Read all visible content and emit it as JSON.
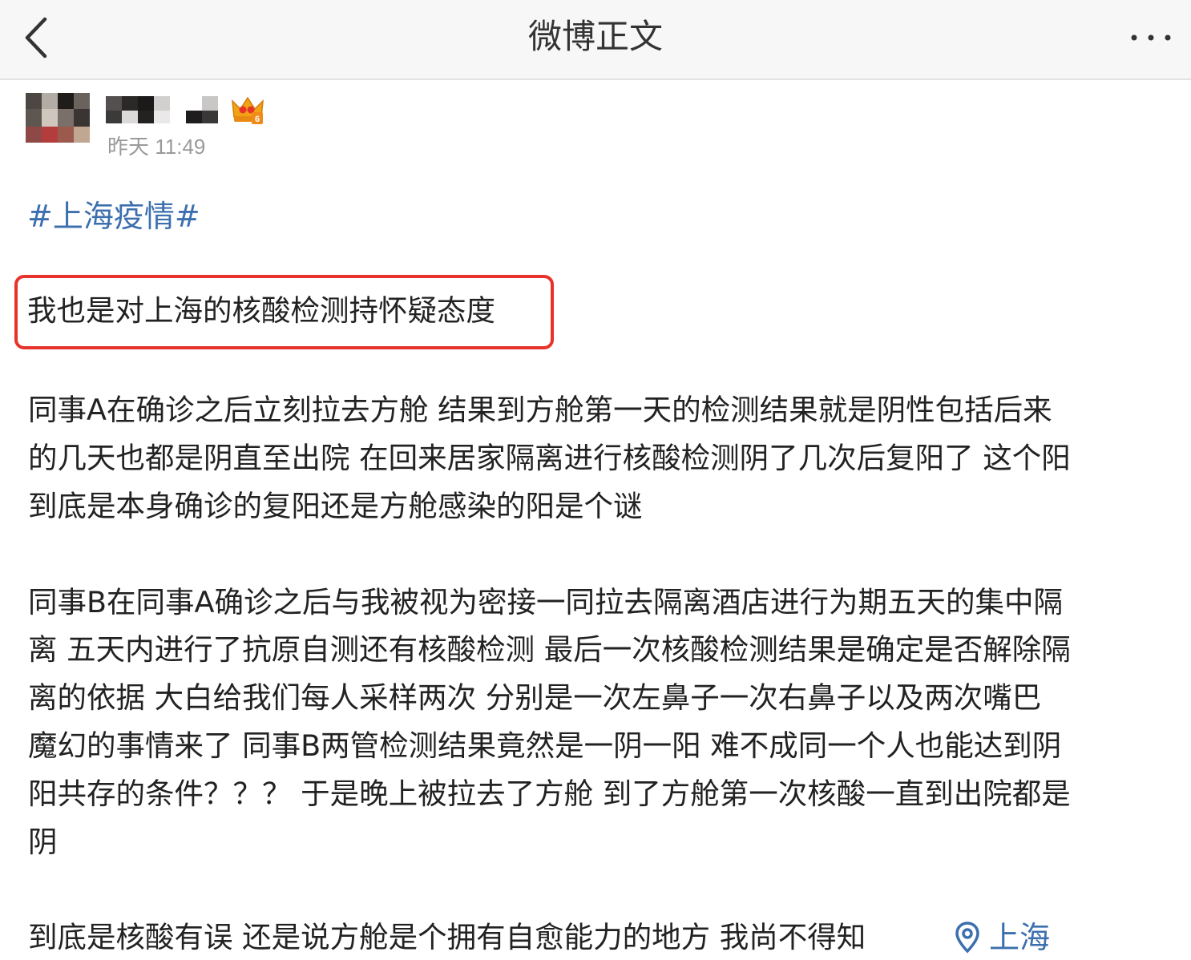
{
  "navbar": {
    "title": "微博正文",
    "back_icon": "chevron-left-icon",
    "more_icon": "more-dots-icon"
  },
  "post": {
    "timestamp": "昨天 11:49",
    "topic": "#上海疫情#",
    "highlighted_sentence": "我也是对上海的核酸检测持怀疑态度",
    "paragraph_1": [
      "同事A在确诊之后立刻拉去方舱 结果到方舱第一天的检测结果就是阴性包括后来",
      "的几天也都是阴直至出院 在回来居家隔离进行核酸检测阴了几次后复阳了 这个阳",
      "到底是本身确诊的复阳还是方舱感染的阳是个谜"
    ],
    "paragraph_2": [
      "同事B在同事A确诊之后与我被视为密接一同拉去隔离酒店进行为期五天的集中隔",
      "离 五天内进行了抗原自测还有核酸检测 最后一次核酸检测结果是确定是否解除隔",
      "离的依据 大白给我们每人采样两次 分别是一次左鼻子一次右鼻子以及两次嘴巴",
      "魔幻的事情来了 同事B两管检测结果竟然是一阴一阳 难不成同一个人也能达到阴",
      "阳共存的条件？？？ 于是晚上被拉去了方舱 到了方舱第一次核酸一直到出院都是",
      "阴"
    ],
    "paragraph_3": "到底是核酸有误 还是说方舱是个拥有自愈能力的地方 我尚不得知",
    "location": "上海",
    "location_icon": "location-pin-icon",
    "badge_level": "6"
  },
  "colors": {
    "link": "#3c6fae",
    "highlight_border": "#e8332a",
    "timestamp": "#9a9a9a",
    "navbar_bg": "#f7f7f7"
  }
}
